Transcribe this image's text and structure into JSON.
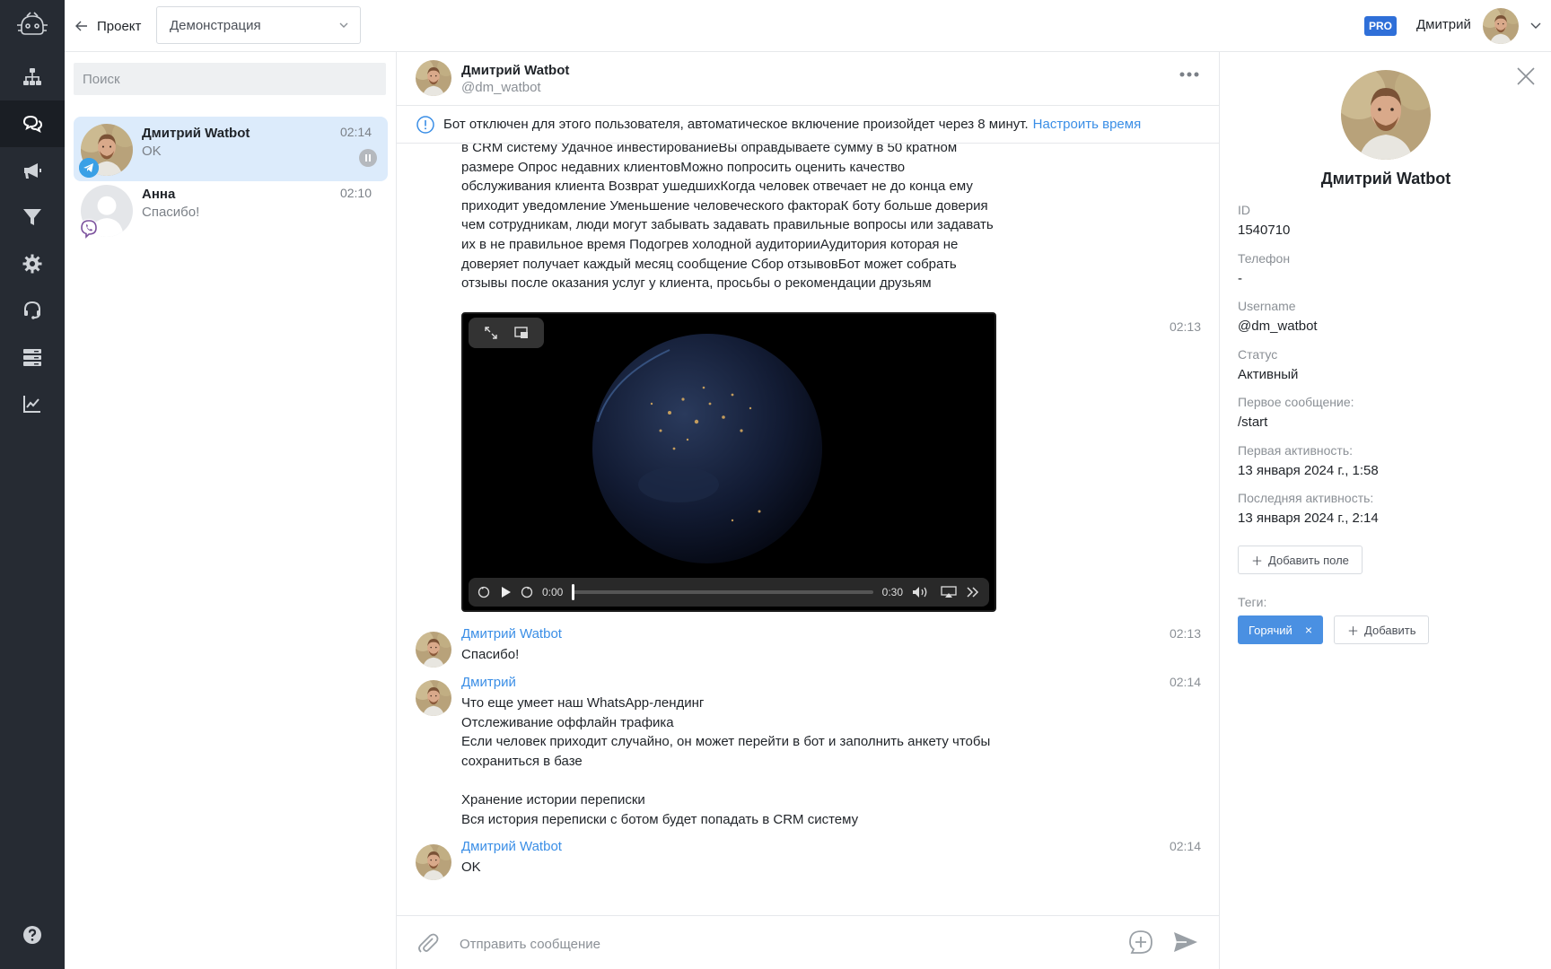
{
  "header": {
    "back_label": "Проект",
    "project": "Демонстрация",
    "badge": "PRO",
    "user_name": "Дмитрий"
  },
  "chatlist": {
    "search_placeholder": "Поиск",
    "chats": [
      {
        "name": "Дмитрий Watbot",
        "preview": "OK",
        "time": "02:14",
        "channel": "telegram-icon",
        "paused": true,
        "active": true
      },
      {
        "name": "Анна",
        "preview": "Спасибо!",
        "time": "02:10",
        "channel": "viber-icon",
        "paused": false,
        "active": false
      }
    ]
  },
  "conversation": {
    "name": "Дмитрий Watbot",
    "handle": "@dm_watbot",
    "notice": "Бот отключен для этого пользователя, автоматическое включение произойдет через 8 минут.",
    "notice_link": "Настроить время",
    "first_message_lines": [
      "в CRM систему Удачное инвестированиеВы оправдываете сумму в 50 кратном",
      "размере Опрос недавних клиентовМожно попросить оценить качество",
      "обслуживания клиента Возврат ушедшихКогда человек отвечает не до конца ему",
      "приходит уведомление Уменьшение человеческого фактораК боту больше доверия",
      "чем сотрудникам, люди могут забывать задавать правильные вопросы или задавать",
      "их в не правильное время Подогрев холодной аудиторииАудитория которая не",
      "доверяет получает каждый месяц сообщение Сбор отзывовБот может собрать",
      "отзывы после оказания услуг у клиента, просьбы о рекомендации друзьям"
    ],
    "video": {
      "time_current": "0:00",
      "time_total": "0:30",
      "progress": 0,
      "sent_time": "02:13"
    },
    "messages": [
      {
        "sender": "Дмитрий Watbot",
        "time": "02:13",
        "lines": [
          "Спасибо!"
        ]
      },
      {
        "sender": "Дмитрий",
        "time": "02:14",
        "lines": [
          "Что еще умеет наш WhatsApp-лендинг",
          "Отслеживание оффлайн трафика",
          "Если человек приходит случайно, он может перейти в бот и заполнить анкету чтобы",
          "сохраниться в базе",
          "",
          "Хранение истории переписки",
          "Вся история переписки с ботом будет попадать в CRM систему"
        ]
      },
      {
        "sender": "Дмитрий Watbot",
        "time": "02:14",
        "lines": [
          "OK"
        ]
      }
    ],
    "composer_placeholder": "Отправить сообщение"
  },
  "profile": {
    "name": "Дмитрий Watbot",
    "fields": [
      {
        "label": "ID",
        "value": "1540710"
      },
      {
        "label": "Телефон",
        "value": "-"
      },
      {
        "label": "Username",
        "value": "@dm_watbot"
      },
      {
        "label": "Статус",
        "value": "Активный"
      },
      {
        "label": "Первое сообщение:",
        "value": "/start"
      },
      {
        "label": "Первая активность:",
        "value": "13 января 2024 г., 1:58"
      },
      {
        "label": "Последняя активность:",
        "value": "13 января 2024 г., 2:14"
      }
    ],
    "add_field_label": "Добавить поле",
    "tags_label": "Теги:",
    "tags": [
      "Горячий"
    ],
    "add_tag_label": "Добавить"
  },
  "colors": {
    "rail": "#262b33",
    "accent": "#3a8ee6",
    "active_chat": "#dcebfb",
    "tag": "#4a90e2",
    "pro": "#2f6fd8"
  }
}
